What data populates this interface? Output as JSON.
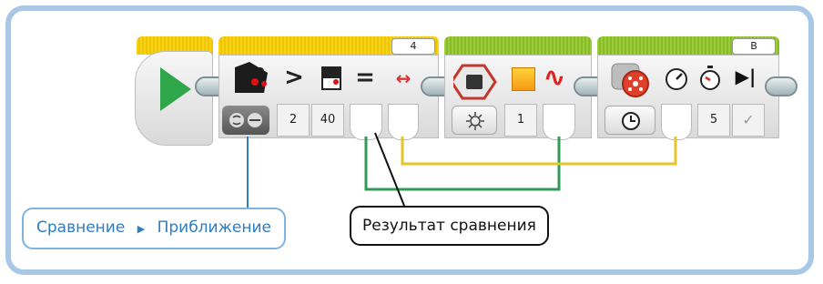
{
  "colors": {
    "frame": "#a9c8e8",
    "start_arrow": "#2fa64a",
    "comparison_wire": "#2f9b55",
    "sensor_wire": "#e2c62b",
    "pointer_line": "#2f7dc2",
    "label_text_blue": "#2f7dc2"
  },
  "blocks": {
    "start": {
      "icon": "play-arrow-icon"
    },
    "compare": {
      "header_value": "4",
      "icons": [
        "sensor-icon",
        "greater-than-icon",
        "mode-icon",
        "equals-icon",
        "range-icon"
      ],
      "mode_button_icon": "compare-mode-icon",
      "inputs": [
        "2",
        "40"
      ]
    },
    "light": {
      "icons": [
        "brick-light-icon",
        "color-icon",
        "pulse-icon"
      ],
      "mode_button_icon": "lamp-icon",
      "inputs": [
        "1"
      ]
    },
    "motor": {
      "header_value": "B",
      "icons": [
        "motor-icon",
        "speed-icon",
        "timer-icon",
        "brake-icon"
      ],
      "mode_button_icon": "clock-mode-icon",
      "inputs": [
        "5",
        "✓"
      ]
    }
  },
  "glyphs": {
    "greater_than": ">",
    "equals": "=",
    "range": "↔",
    "pulse": "∿",
    "brake": "▶|",
    "checkmark": "✓"
  },
  "labels": {
    "comparison_prefix": "Сравнение",
    "comparison_arrow": "▶",
    "comparison_mode": "Приближение",
    "result": "Результат сравнения"
  }
}
